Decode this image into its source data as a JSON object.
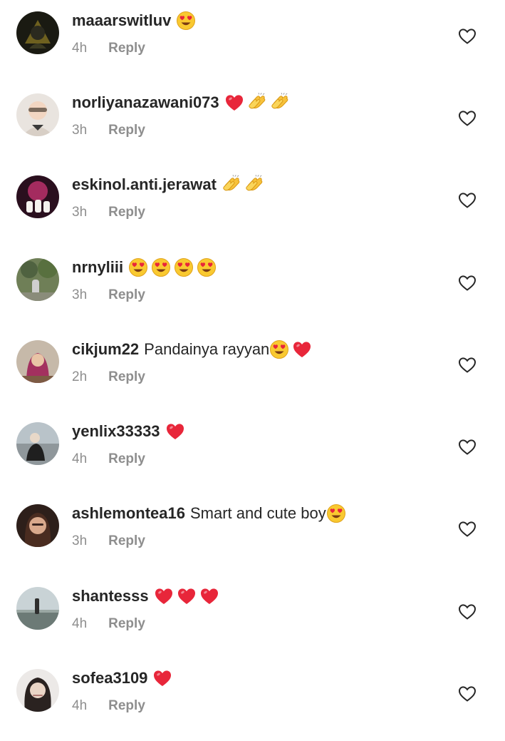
{
  "comments": [
    {
      "username": "maaarswitluv",
      "text": "",
      "emojis": [
        "heart-eyes"
      ],
      "time": "4h",
      "reply": "Reply"
    },
    {
      "username": "norliyanazawani073",
      "text": "",
      "emojis": [
        "red-heart",
        "clapping-hands",
        "clapping-hands"
      ],
      "time": "3h",
      "reply": "Reply"
    },
    {
      "username": "eskinol.anti.jerawat",
      "text": "",
      "emojis": [
        "clapping-hands",
        "clapping-hands"
      ],
      "time": "3h",
      "reply": "Reply"
    },
    {
      "username": "nrnyliii",
      "text": "",
      "emojis": [
        "heart-eyes",
        "heart-eyes",
        "heart-eyes",
        "heart-eyes"
      ],
      "time": "3h",
      "reply": "Reply"
    },
    {
      "username": "cikjum22",
      "text": "Pandainya rayyan",
      "emojis": [
        "heart-eyes",
        "red-heart"
      ],
      "time": "2h",
      "reply": "Reply"
    },
    {
      "username": "yenlix33333",
      "text": "",
      "emojis": [
        "red-heart"
      ],
      "time": "4h",
      "reply": "Reply"
    },
    {
      "username": "ashlemontea16",
      "text": "Smart and cute boy",
      "emojis": [
        "heart-eyes"
      ],
      "time": "3h",
      "reply": "Reply"
    },
    {
      "username": "shantesss",
      "text": "",
      "emojis": [
        "red-heart",
        "red-heart",
        "red-heart"
      ],
      "time": "4h",
      "reply": "Reply"
    },
    {
      "username": "sofea3109",
      "text": "",
      "emojis": [
        "red-heart"
      ],
      "time": "4h",
      "reply": "Reply"
    }
  ],
  "colors": {
    "username": "#262626",
    "meta": "#8e8e8e",
    "like_outline": "#262626"
  },
  "icons": {
    "like": "heart-outline-icon",
    "avatar": "avatar"
  }
}
